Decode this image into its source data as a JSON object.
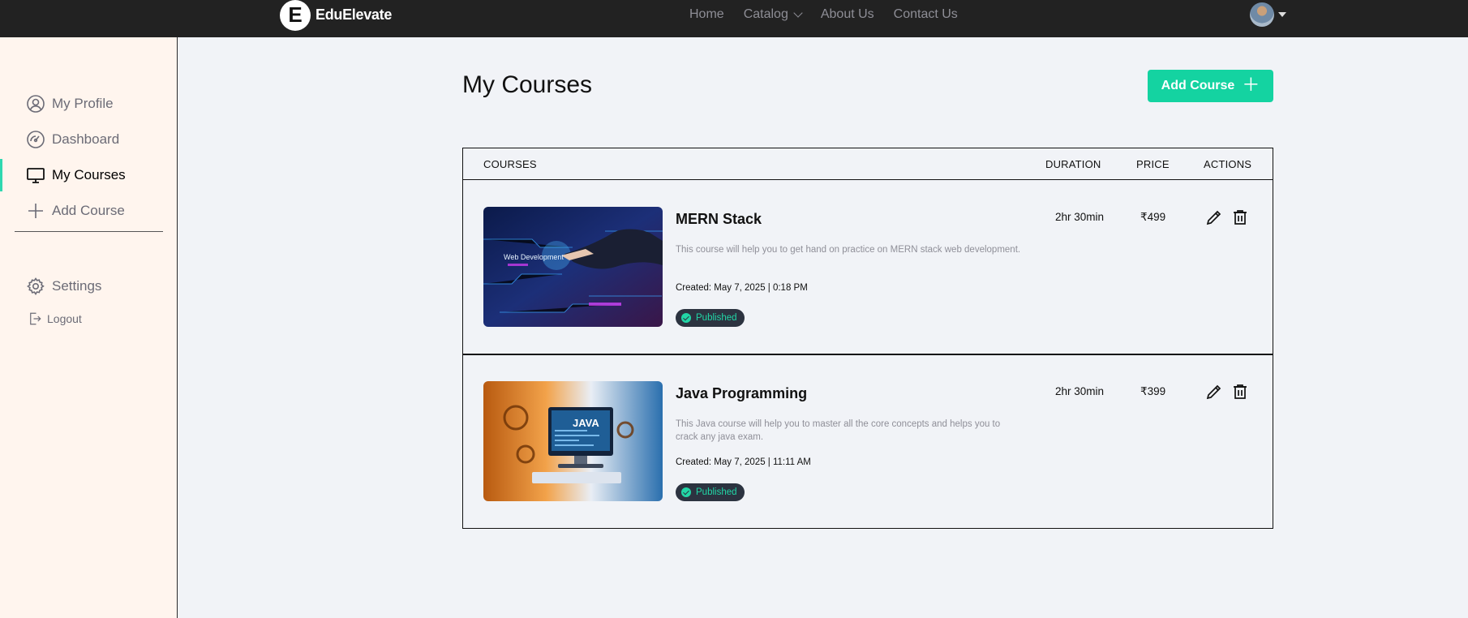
{
  "brand": {
    "mark": "E",
    "name": "EduElevate"
  },
  "nav": {
    "home": "Home",
    "catalog": "Catalog",
    "about": "About Us",
    "contact": "Contact Us"
  },
  "sidebar": {
    "items": [
      {
        "label": "My Profile",
        "icon": "user-circle-icon"
      },
      {
        "label": "Dashboard",
        "icon": "gauge-icon"
      },
      {
        "label": "My Courses",
        "icon": "monitor-icon",
        "active": true
      },
      {
        "label": "Add Course",
        "icon": "plus-icon"
      }
    ],
    "settings": "Settings",
    "logout": "Logout"
  },
  "main": {
    "title": "My Courses",
    "add_button": "Add Course",
    "add_button_icon": "＋",
    "headers": {
      "courses": "COURSES",
      "duration": "DURATION",
      "price": "PRICE",
      "actions": "ACTIONS"
    },
    "courses": [
      {
        "title": "MERN Stack",
        "description": "This course will help you to get hand on practice on MERN stack web development.",
        "created": "Created: May 7, 2025 | 0:18 PM",
        "status": "Published",
        "duration": "2hr 30min",
        "price": "₹499",
        "thumbnail_text": "Web Development"
      },
      {
        "title": "Java Programming",
        "description": "This Java course will help you to master all the core concepts and helps you to crack any java exam.",
        "created": "Created: May 7, 2025 | 11:11 AM",
        "status": "Published",
        "duration": "2hr 30min",
        "price": "₹399",
        "thumbnail_text": "JAVA"
      }
    ]
  },
  "colors": {
    "accent": "#14d3a1",
    "topbar": "#222222",
    "sidebar_bg": "#fff5ee",
    "page_bg": "#f1f3f7",
    "badge_bg": "#2c3340"
  }
}
